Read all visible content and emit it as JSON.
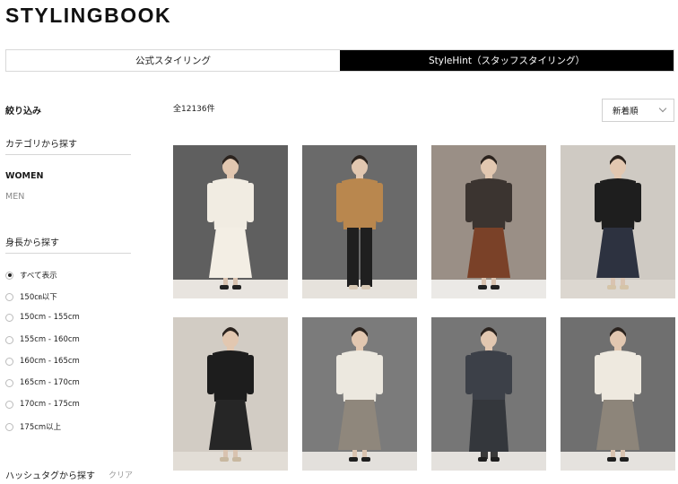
{
  "brand": {
    "logo_text": "STYLINGBOOK"
  },
  "tabs": [
    {
      "label": "公式スタイリング",
      "active": false
    },
    {
      "label": "StyleHint（スタッフスタイリング）",
      "active": true
    }
  ],
  "sidebar": {
    "title": "絞り込み",
    "category_heading": "カテゴリから探す",
    "categories": [
      {
        "label": "WOMEN",
        "selected": true
      },
      {
        "label": "MEN",
        "selected": false
      }
    ],
    "height_heading": "身長から探す",
    "height_options": [
      {
        "label": "すべて表示",
        "checked": true
      },
      {
        "label": "150㎝以下",
        "checked": false
      },
      {
        "label": "150cm - 155cm",
        "checked": false
      },
      {
        "label": "155cm - 160cm",
        "checked": false
      },
      {
        "label": "160cm - 165cm",
        "checked": false
      },
      {
        "label": "165cm - 170cm",
        "checked": false
      },
      {
        "label": "170cm - 175cm",
        "checked": false
      },
      {
        "label": "175cm以上",
        "checked": false
      }
    ],
    "hashtag_heading": "ハッシュタグから探す",
    "clear_label": "クリア"
  },
  "results": {
    "count_label": "全12136件"
  },
  "sort": {
    "selected": "新着順"
  },
  "colors": {
    "active_tab_bg": "#000000",
    "text": "#1a1a1a",
    "muted": "#888888"
  },
  "cards": [
    {
      "bg": "#5f5f5f",
      "floor": "#e8e4df",
      "top": "#f1ece2",
      "bottom": "#f3eee4",
      "bottom_type": "skirt",
      "shoes": "#222222"
    },
    {
      "bg": "#6a6a6a",
      "floor": "#e6e2dc",
      "top": "#b9874e",
      "bottom": "#1f1f1f",
      "bottom_type": "pants",
      "shoes": "#d8c9b5"
    },
    {
      "bg": "#9a8f86",
      "floor": "#ebe9e6",
      "top": "#3b3430",
      "bottom": "#7a4128",
      "bottom_type": "skirt",
      "shoes": "#222222"
    },
    {
      "bg": "#cfcac3",
      "floor": "#dcd7d0",
      "top": "#1e1e1e",
      "bottom": "#2d3240",
      "bottom_type": "skirt",
      "shoes": "#d5c4a8"
    },
    {
      "bg": "#d2ccc4",
      "floor": "#e2ddd6",
      "top": "#1d1d1d",
      "bottom": "#262626",
      "bottom_type": "skirt",
      "shoes": "#c8b8a0"
    },
    {
      "bg": "#7b7b7b",
      "floor": "#e3e0dc",
      "top": "#ece8df",
      "bottom": "#8f877c",
      "bottom_type": "skirt",
      "shoes": "#1f1f1f"
    },
    {
      "bg": "#767676",
      "floor": "#e4e1dd",
      "top": "#3c4048",
      "bottom": "#34373c",
      "bottom_type": "coat",
      "shoes": "#1f1f1f"
    },
    {
      "bg": "#6f6f6f",
      "floor": "#e5e2de",
      "top": "#eee9df",
      "bottom": "#8d857a",
      "bottom_type": "skirt",
      "shoes": "#1f1f1f"
    }
  ]
}
